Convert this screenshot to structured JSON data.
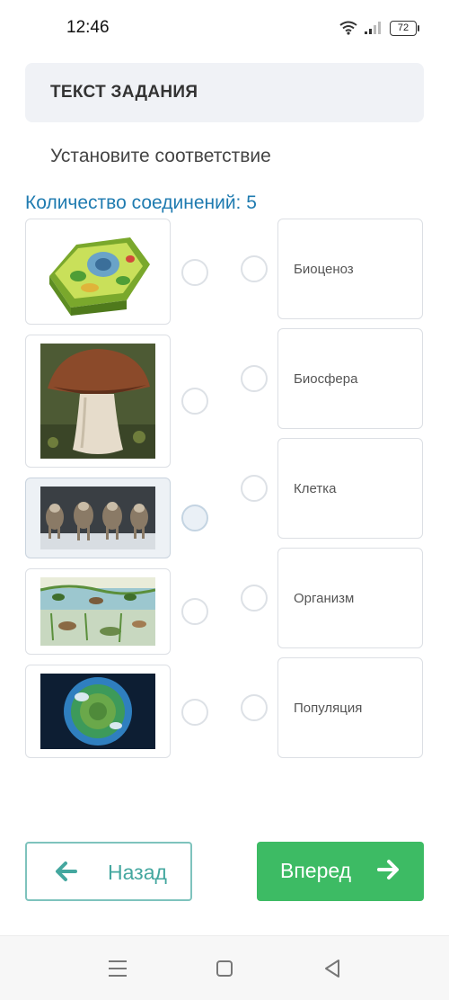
{
  "status": {
    "time": "12:46",
    "battery": "72"
  },
  "task": {
    "title": "ТЕКСТ ЗАДАНИЯ",
    "instruction": "Установите соответствие",
    "count_text": "Количество соединений: 5"
  },
  "left_items": [
    {
      "icon": "plant-cell-image"
    },
    {
      "icon": "mushroom-image"
    },
    {
      "icon": "wolves-image",
      "selected": true
    },
    {
      "icon": "pond-ecosystem-image"
    },
    {
      "icon": "earth-globe-image"
    }
  ],
  "right_items": [
    {
      "label": "Биоценоз"
    },
    {
      "label": "Биосфера"
    },
    {
      "label": "Клетка"
    },
    {
      "label": "Организм"
    },
    {
      "label": "Популяция"
    }
  ],
  "buttons": {
    "back": "Назад",
    "next": "Вперед"
  },
  "colors": {
    "accent_blue": "#1f7bb0",
    "next_green": "#3dbb64",
    "back_teal": "#44a79f"
  }
}
